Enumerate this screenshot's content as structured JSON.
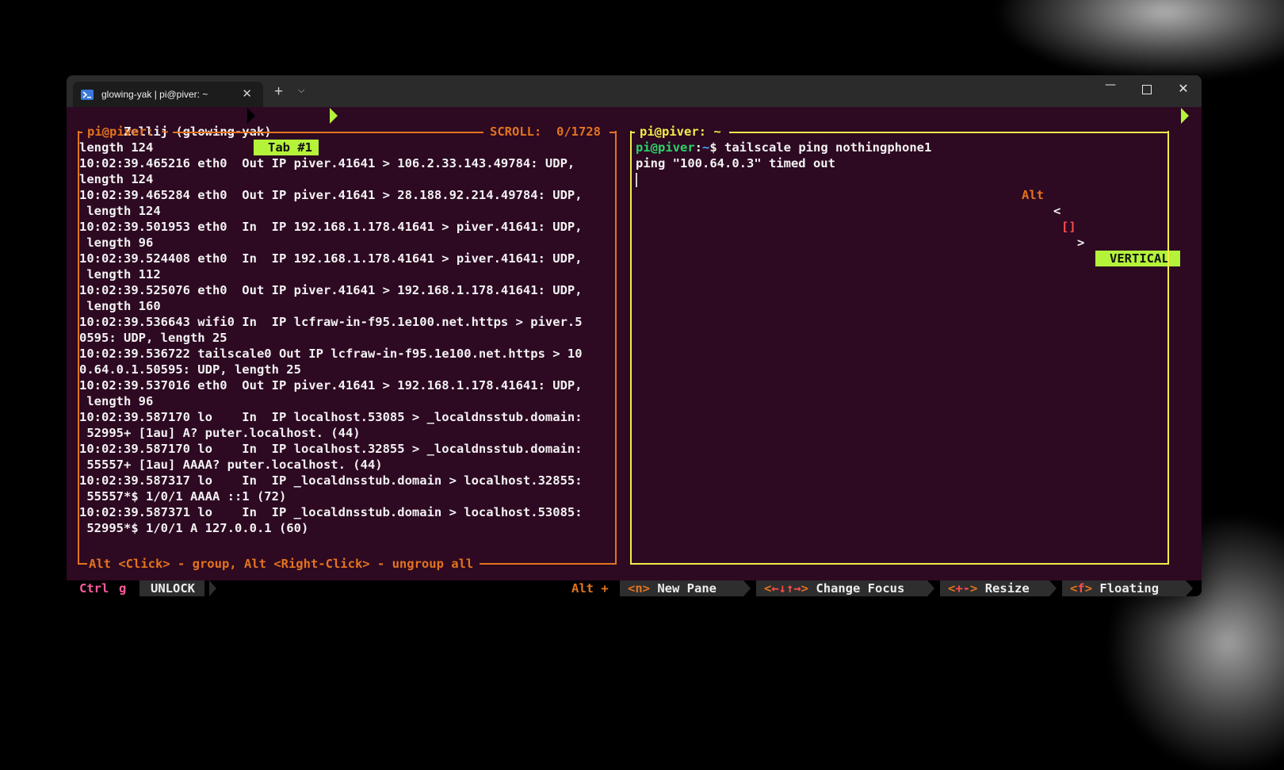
{
  "window": {
    "tab_title": "glowing-yak | pi@piver: ~",
    "tab_icon": "powershell-icon",
    "new_tab_symbol": "+",
    "tab_menu_symbol": "⌵",
    "close_symbol": "✕",
    "minimize_symbol": "—",
    "window_close_symbol": "✕"
  },
  "zellij": {
    "session_title": "Zellij (glowing-yak)",
    "active_tab": "Tab #1",
    "mode_alt": "Alt",
    "mode_brackets_open": "<",
    "mode_brackets_inner": "[]",
    "mode_brackets_close": ">",
    "layout": "VERTICAL"
  },
  "left_pane": {
    "title": "pi@piver: ~",
    "scroll": "SCROLL:  0/1728",
    "lines": [
      "length 124",
      "10:02:39.465216 eth0  Out IP piver.41641 > 106.2.33.143.49784: UDP,",
      "length 124",
      "10:02:39.465284 eth0  Out IP piver.41641 > 28.188.92.214.49784: UDP,",
      " length 124",
      "10:02:39.501953 eth0  In  IP 192.168.1.178.41641 > piver.41641: UDP,",
      " length 96",
      "10:02:39.524408 eth0  In  IP 192.168.1.178.41641 > piver.41641: UDP,",
      " length 112",
      "10:02:39.525076 eth0  Out IP piver.41641 > 192.168.1.178.41641: UDP,",
      " length 160",
      "10:02:39.536643 wifi0 In  IP lcfraw-in-f95.1e100.net.https > piver.5",
      "0595: UDP, length 25",
      "10:02:39.536722 tailscale0 Out IP lcfraw-in-f95.1e100.net.https > 10",
      "0.64.0.1.50595: UDP, length 25",
      "10:02:39.537016 eth0  Out IP piver.41641 > 192.168.1.178.41641: UDP,",
      " length 96",
      "10:02:39.587170 lo    In  IP localhost.53085 > _localdnsstub.domain:",
      " 52995+ [1au] A? puter.localhost. (44)",
      "10:02:39.587170 lo    In  IP localhost.32855 > _localdnsstub.domain:",
      " 55557+ [1au] AAAA? puter.localhost. (44)",
      "10:02:39.587317 lo    In  IP _localdnsstub.domain > localhost.32855:",
      " 55557*$ 1/0/1 AAAA ::1 (72)",
      "10:02:39.587371 lo    In  IP _localdnsstub.domain > localhost.53085:",
      " 52995*$ 1/0/1 A 127.0.0.1 (60)"
    ],
    "footer": "Alt <Click> - group, Alt <Right-Click> - ungroup all"
  },
  "right_pane": {
    "title": "pi@piver: ~",
    "prompt_user": "pi@piver",
    "prompt_sep": ":",
    "prompt_path": "~",
    "prompt_symbol": "$",
    "command": " tailscale ping nothingphone1",
    "output": "ping \"100.64.0.3\" timed out"
  },
  "statusbar": {
    "ctrl": "Ctrl",
    "g": "g",
    "lock_label": "UNLOCK",
    "alt_plus": "Alt +",
    "new_pane_key": "<n>",
    "new_pane_label": "New Pane",
    "focus_key_open": "<",
    "focus_key_arrows": "←↓↑→",
    "focus_key_close": ">",
    "focus_label": "Change Focus",
    "resize_key_open": "<",
    "resize_key_inner": "+-",
    "resize_key_close": ">",
    "resize_label": "Resize",
    "float_key_open": "<",
    "float_key_inner": "f",
    "float_key_close": ">",
    "float_label": "Floating"
  },
  "colors": {
    "terminal_bg": "#2d0922",
    "focused_border": "#f2ed4a",
    "unfocused_border": "#e3731e",
    "accent_green": "#b5f23a"
  }
}
